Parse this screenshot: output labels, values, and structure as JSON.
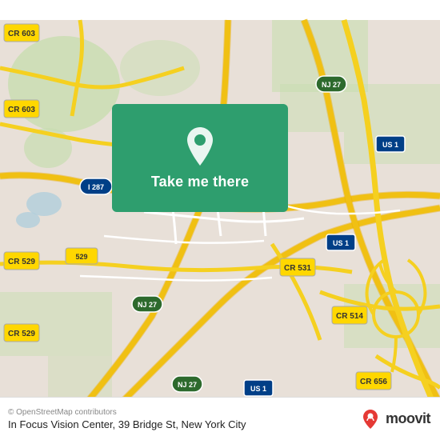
{
  "map": {
    "background_color": "#e8e0d8",
    "center": {
      "lat": 40.49,
      "lng": -74.45
    }
  },
  "overlay": {
    "button_label": "Take me there",
    "background_color": "#2e9e6e"
  },
  "bottom_bar": {
    "copyright": "© OpenStreetMap contributors",
    "location": "In Focus Vision Center, 39 Bridge St, New York City",
    "brand": "moovit"
  }
}
